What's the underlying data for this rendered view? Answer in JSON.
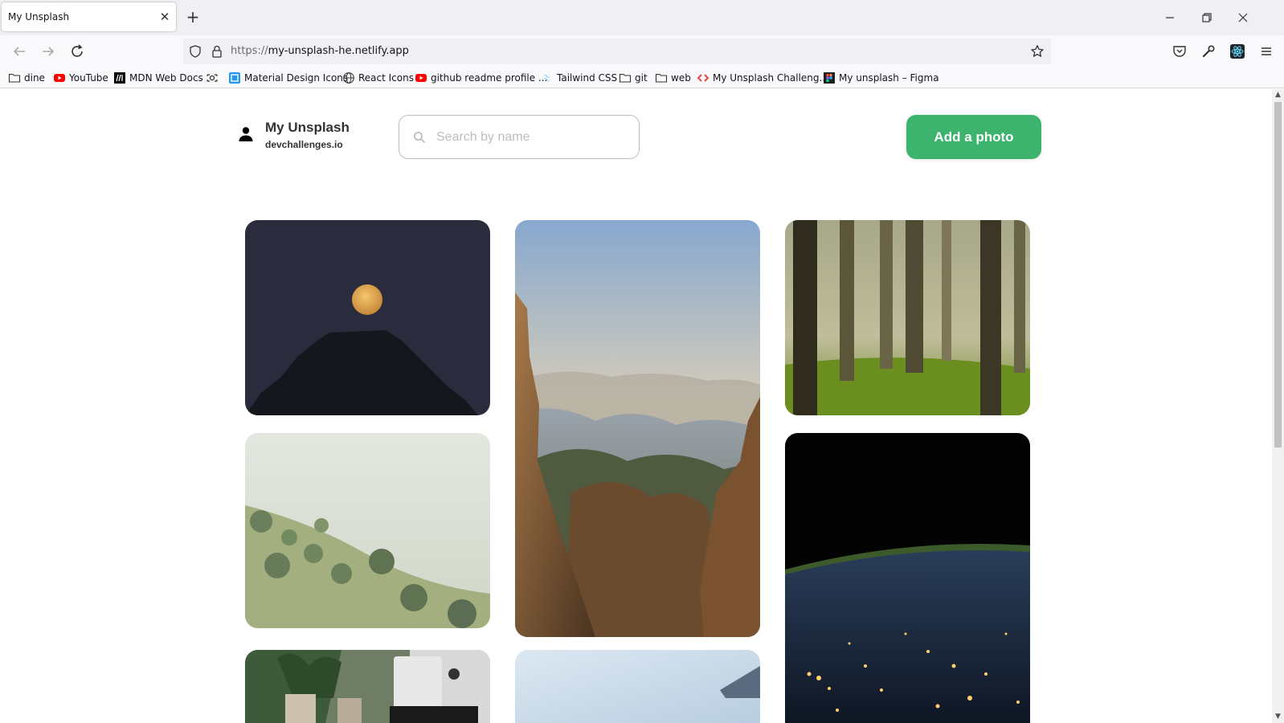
{
  "browser": {
    "tab_title": "My Unsplash",
    "url_scheme": "https://",
    "url_host": "my-unsplash-he.netlify.app",
    "bookmarks": [
      {
        "label": "dine",
        "icon": "folder-icon"
      },
      {
        "label": "YouTube",
        "icon": "youtube-icon"
      },
      {
        "label": "MDN Web Docs",
        "icon": "mdn-icon"
      },
      {
        "label": "",
        "icon": "camera-icon"
      },
      {
        "label": "Material Design Icons",
        "icon": "material-icon"
      },
      {
        "label": "React Icons",
        "icon": "globe-icon"
      },
      {
        "label": "github readme profile ...",
        "icon": "youtube-icon"
      },
      {
        "label": "Tailwind CSS",
        "icon": "tailwind-icon"
      },
      {
        "label": "git",
        "icon": "folder-icon"
      },
      {
        "label": "web",
        "icon": "folder-icon"
      },
      {
        "label": "My Unsplash Challeng...",
        "icon": "devchallenges-icon"
      },
      {
        "label": "My unsplash – Figma",
        "icon": "figma-icon"
      }
    ]
  },
  "header": {
    "title": "My Unsplash",
    "subtitle": "devchallenges.io",
    "search_placeholder": "Search by name",
    "add_button": "Add a photo"
  },
  "colors": {
    "accent": "#3db46d"
  },
  "photos": [
    {
      "subject": "moon over mountain"
    },
    {
      "subject": "canyon at sunset"
    },
    {
      "subject": "misty forest"
    },
    {
      "subject": "foggy hills"
    },
    {
      "subject": "earth at night"
    },
    {
      "subject": "desk with plants"
    },
    {
      "subject": "sky"
    }
  ]
}
